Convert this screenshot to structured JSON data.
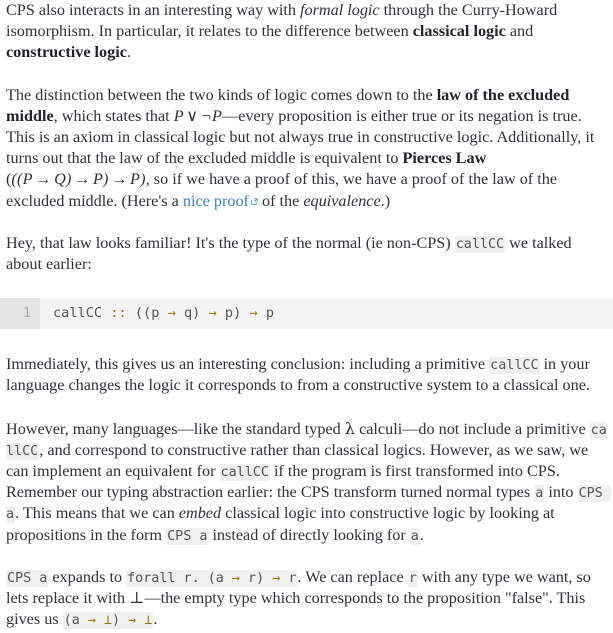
{
  "article": {
    "paragraphs": {
      "p1": {
        "seg1": "CPS also interacts in an interesting way with ",
        "em1": "formal logic",
        "seg2": " through the Curry-Howard isomorphism. In particular, it relates to the difference between ",
        "b1": "classical logic",
        "seg3": " and ",
        "b2": "constructive logic",
        "seg4": "."
      },
      "p2": {
        "seg1": "The distinction between the two kinds of logic comes down to the ",
        "b1": "law of the excluded middle",
        "seg2": ", which states that ",
        "math1_p": "P",
        "math1_or": "∨",
        "math1_negp": "¬P",
        "seg3": "—every proposition is either true or its negation is true. This is an axiom in classical logic but not always true in constructive logic. Additionally, it turns out that the law of the excluded middle is equivalent to ",
        "b2": "Pierces Law",
        "seg4": " (",
        "math2_a": "((P",
        "math2_arrow1": "→",
        "math2_b": "Q)",
        "math2_arrow2": "→",
        "math2_c": "P)",
        "math2_arrow3": "→",
        "math2_d": "P)",
        "seg5": ", so if we have a proof of this, we have a proof of the law of the excluded middle. (Here's a ",
        "link_text": "nice proof",
        "link_icon": "external-link-icon",
        "seg6": " of the ",
        "em1": "equivalence",
        "seg7": ".)"
      },
      "p3": {
        "seg1": "Hey, that law looks familiar! It's the type of the normal (ie non-CPS) ",
        "code1": "callCC",
        "seg2": " we talked about earlier:"
      },
      "p4": {
        "seg1": "Immediately, this gives us an interesting conclusion: including a primitive ",
        "code1": "callCC",
        "seg2": " in your language changes the logic it corresponds to from a constructive system to a classical one."
      },
      "p5": {
        "seg1": "However, many languages—like the standard typed ",
        "lambda": "λ",
        "seg2": " calculi—do not include a primitive ",
        "code1": "callCC",
        "seg3": ", and correspond to constructive rather than classical logics. However, as we saw, we can implement an equivalent for ",
        "code2": "callCC",
        "seg4": " if the program is first transformed into CPS. Remember our typing abstraction earlier: the CPS transform turned normal types ",
        "code3": "a",
        "seg5": " into ",
        "code4": "CPS a",
        "seg6": ". This means that we can ",
        "em1": "embed",
        "seg7": " classical logic into constructive logic by looking at propositions in the form ",
        "code5": "CPS a",
        "seg8": " instead of directly looking for ",
        "code6": "a",
        "seg9": "."
      },
      "p6": {
        "code1": "CPS a",
        "seg1": " expands to ",
        "code2_kw": "forall r. (a ",
        "code2_arrow1": "→",
        "code2_mid": " r) ",
        "code2_arrow2": "→",
        "code2_end": " r",
        "seg2": ". We can replace ",
        "code3": "r",
        "seg3": " with any type we want, so lets replace it with ",
        "bottom": "⊥",
        "seg4": "—the empty type which corresponds to the proposition \"false\". This gives us ",
        "code4_open": "(a ",
        "code4_arrow1": "→",
        "code4_bot1": " ⊥",
        "code4_close": ") ",
        "code4_arrow2": "→",
        "code4_bot2": " ⊥",
        "seg5": "."
      }
    },
    "code_block": {
      "line_number": "1",
      "tokens": {
        "name": "callCC ",
        "coloncolon": "::",
        "open": " ((p ",
        "arrow1": "→",
        "q": " q) ",
        "arrow2": "→",
        "p": " p) ",
        "arrow3": "→",
        "tail": " p"
      }
    }
  },
  "colors": {
    "text": "#2f3337",
    "link": "#3f7fbf",
    "code_text": "#555555",
    "code_operator": "#8a8112",
    "inline_code_bg": "#f0f0f0",
    "code_block_bg": "#f4f4f4",
    "gutter_bg": "#e4e4e4",
    "gutter_text": "#a8a8a8"
  }
}
